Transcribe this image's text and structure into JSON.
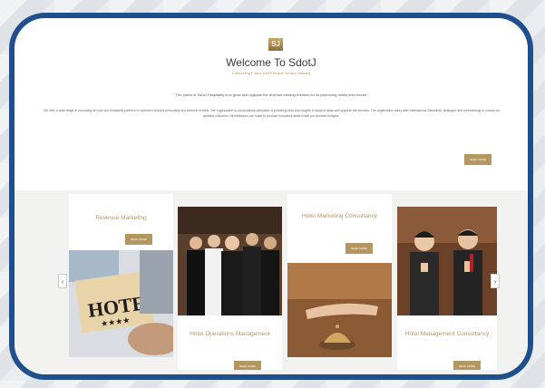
{
  "hero": {
    "logo_text": "SJ",
    "title": "Welcome To SdotJ",
    "subtitle": "Connecting Future with Efficient Service Globally",
    "quote": "“ The vision of SdotJ Hospitality is to grow and upgrade the revenue earning frontiers for its partnering hotels and resorts ”",
    "description": "SdJ offer a wide range of promoting its hotel and hospitality partners to represent a brand personality and revenue models. The organization is consequently dedicated to providing tools and insights to support deals and upgrade the services. The organization takes after International Standards, strategies and methodology to convert all greatest outcomes. All endeavors are made to produce innovative deals inside pre-decided budgets.",
    "read_more": "READ MORE"
  },
  "cards": [
    {
      "title": "Revenue Marketing",
      "button": "READ MORE",
      "image": "hotel-sign-photo"
    },
    {
      "title": "Hotel Operations Management",
      "button": "READ MORE",
      "image": "hotel-staff-photo"
    },
    {
      "title": "Hotel Marketing Consultancy",
      "button": "READ MORE",
      "image": "reception-bell-photo"
    },
    {
      "title": "Hotel Management Consultancy",
      "button": "READ MORE",
      "image": "greeting-staff-photo"
    }
  ],
  "carousel": {
    "prev": "‹",
    "next": "›"
  },
  "colors": {
    "frame": "#1f4f8c",
    "accent": "#b39660"
  }
}
